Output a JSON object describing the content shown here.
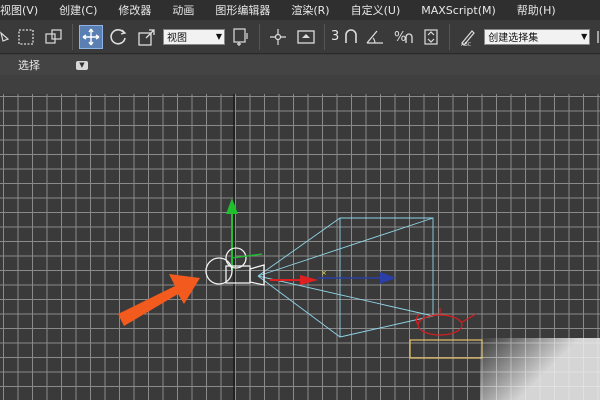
{
  "menubar": {
    "items": [
      "视图(V)",
      "创建(C)",
      "修改器",
      "动画",
      "图形编辑器",
      "渲染(R)",
      "自定义(U)",
      "MAXScript(M)",
      "帮助(H)"
    ]
  },
  "toolbar": {
    "view_dropdown": "视图",
    "snap_label": "3",
    "selection_set_dropdown": "创建选择集"
  },
  "ribbon": {
    "label": "选择"
  },
  "viewport": {
    "grid_color": "#8a8a8a",
    "background_color": "#3a3a3a",
    "arrow_color": "#f25a1e"
  }
}
